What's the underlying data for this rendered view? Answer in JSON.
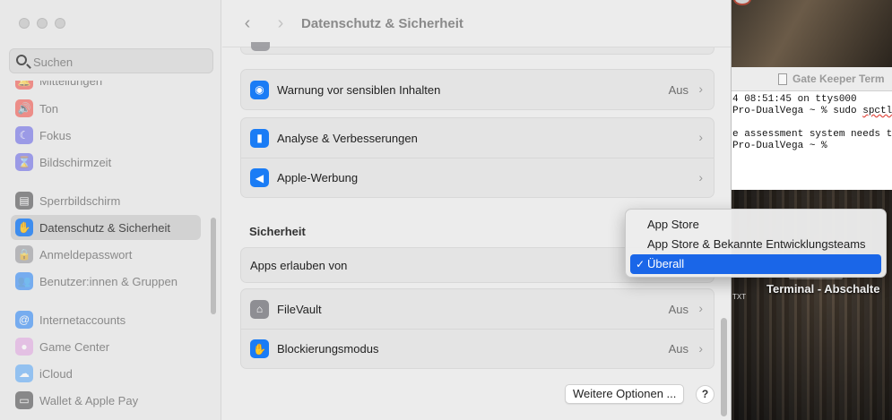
{
  "window": {
    "title": "Datenschutz & Sicherheit",
    "nav_back": "‹",
    "nav_forward": "›"
  },
  "sidebar": {
    "search_placeholder": "Suchen",
    "items": [
      {
        "label": "Mitteilungen",
        "icon": "bell-icon",
        "color": "#f0443a",
        "glyph": "🔔"
      },
      {
        "label": "Ton",
        "icon": "speaker-icon",
        "color": "#f0443a",
        "glyph": "🔊"
      },
      {
        "label": "Fokus",
        "icon": "moon-icon",
        "color": "#5e5ce6",
        "glyph": "☾"
      },
      {
        "label": "Bildschirmzeit",
        "icon": "hourglass-icon",
        "color": "#5e5ce6",
        "glyph": "⌛"
      },
      {
        "label": "Sperrbildschirm",
        "icon": "lock-screen-icon",
        "color": "#3a3a3c",
        "glyph": "▤"
      },
      {
        "label": "Datenschutz & Sicherheit",
        "icon": "hand-icon",
        "color": "#1a7cf5",
        "glyph": "✋"
      },
      {
        "label": "Anmeldepasswort",
        "icon": "lock-icon",
        "color": "#8e8e93",
        "glyph": "🔒"
      },
      {
        "label": "Benutzer:innen & Gruppen",
        "icon": "users-icon",
        "color": "#1a7cf5",
        "glyph": "👥"
      },
      {
        "label": "Internetaccounts",
        "icon": "at-icon",
        "color": "#1a7cf5",
        "glyph": "@"
      },
      {
        "label": "Game Center",
        "icon": "game-center-icon",
        "color": "#e0a0e0",
        "glyph": "●"
      },
      {
        "label": "iCloud",
        "icon": "cloud-icon",
        "color": "#4fa3f7",
        "glyph": "☁"
      },
      {
        "label": "Wallet & Apple Pay",
        "icon": "wallet-icon",
        "color": "#3a3a3c",
        "glyph": "▭"
      }
    ]
  },
  "main": {
    "rows_top": [
      {
        "label": "Warnung vor sensiblen Inhalten",
        "value": "Aus",
        "icon": "eye-icon",
        "glyph": "◉"
      }
    ],
    "rows_analytics": [
      {
        "label": "Analyse & Verbesserungen",
        "value": "",
        "icon": "chart-icon",
        "glyph": "▮"
      },
      {
        "label": "Apple-Werbung",
        "value": "",
        "icon": "megaphone-icon",
        "glyph": "◀"
      }
    ],
    "security_title": "Sicherheit",
    "allow_apps_label": "Apps erlauben von",
    "rows_security": [
      {
        "label": "FileVault",
        "value": "Aus",
        "icon": "house-lock-icon",
        "glyph": "⌂"
      },
      {
        "label": "Blockierungsmodus",
        "value": "Aus",
        "icon": "hand-icon",
        "glyph": "✋"
      }
    ],
    "more_options": "Weitere Optionen ...",
    "help": "?"
  },
  "popup": {
    "options": [
      "App Store",
      "App Store & Bekannte Entwicklungsteams",
      "Überall"
    ],
    "selected": "Überall",
    "check": "✓"
  },
  "terminal": {
    "title": "Gate Keeper Term",
    "lines": [
      "4 08:51:45 on ttys000",
      "Pro-DualVega ~ % sudo spctl --",
      "",
      "e assessment system needs to b",
      "Pro-DualVega ~ %"
    ]
  },
  "desktop": {
    "label": "Terminal - Abschalte",
    "small_label": "TXT"
  }
}
